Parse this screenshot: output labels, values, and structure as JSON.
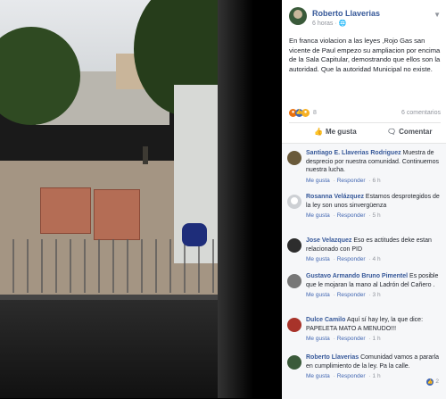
{
  "post": {
    "author": "Roberto Llaverias",
    "time": "6 horas",
    "privacy_icon": "globe-icon",
    "text": "En franca violacion a las leyes ,Rojo Gas san vicente de Paul empezo su ampliacion por encima de la Sala Capitular, demostrando que ellos son la autoridad. Que la autoridad Municipal no existe.",
    "reaction_count": "8",
    "comments_count": "6 comentarios",
    "like_label": "Me gusta",
    "comment_label": "Comentar"
  },
  "comments": [
    {
      "name": "Santiago E. Llaverias Rodriguez",
      "text": "Muestra de desprecio por nuestra comunidad. Continuemos nuestra lucha.",
      "like": "Me gusta",
      "reply": "Responder",
      "time": "6 h"
    },
    {
      "name": "Rosanna Velázquez",
      "text": "Estamos desprotegidos de la ley son unos sinvergüenza",
      "like": "Me gusta",
      "reply": "Responder",
      "time": "5 h"
    },
    {
      "name": "Jose Velazquez",
      "text": "Eso es actitudes deke estan relacionado con PID",
      "like": "Me gusta",
      "reply": "Responder",
      "time": "4 h"
    },
    {
      "name": "Gustavo Armando Bruno Pimentel",
      "text": "Es posible que le mojaran la mano al Ladrón del Cañero .",
      "like": "Me gusta",
      "reply": "Responder",
      "time": "3 h"
    },
    {
      "name": "Dulce Camilo",
      "text": "Aquí sí hay ley, la que dice: PAPELETA MATO A MENUDO!!!",
      "like": "Me gusta",
      "reply": "Responder",
      "time": "1 h"
    },
    {
      "name": "Roberto Llaverias",
      "text": "Comunidad vamos a pararla en cumplimiento de la ley. Pa la calle.",
      "like": "Me gusta",
      "reply": "Responder",
      "time": "1 h",
      "likes": "2"
    }
  ],
  "colors": {
    "link": "#365899",
    "accent": "#4267b2",
    "muted": "#90949c"
  }
}
